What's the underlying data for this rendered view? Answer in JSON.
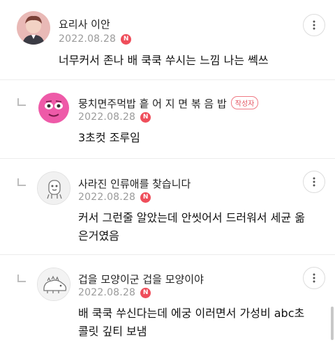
{
  "comments": [
    {
      "nickname": "요리사 이안",
      "date": "2022.08.28",
      "new_badge": "N",
      "body": "너무커서 존나 배 쿡쿡 쑤시는 느낌 나는 쎅쓰",
      "avatar_icon": "photo-avatar",
      "is_reply": false
    },
    {
      "nickname": "뭉치면주먹밥 흩 어 지 면 볶 음 밥",
      "author_badge": "작성자",
      "date": "2022.08.28",
      "new_badge": "N",
      "body": "3초컷 조루임",
      "avatar_icon": "pink-face-avatar",
      "is_reply": true
    },
    {
      "nickname": "사라진 인류애를 찾습니다",
      "date": "2022.08.28",
      "new_badge": "N",
      "body_line1": "커서 그런줄 알았는데 안씻어서 드러워서 세균 옮",
      "body_line2": "은거였음",
      "avatar_icon": "default-character-avatar",
      "is_reply": true
    },
    {
      "nickname": "겁을 모양이군 겁을 모양이야",
      "date": "2022.08.28",
      "new_badge": "N",
      "body_line1": "배 쿡쿡 쑤신다는데 에궁 이러면서 가성비 abc초",
      "body_line2": "콜릿 깊티 보냄",
      "avatar_icon": "dinosaur-avatar",
      "is_reply": true
    }
  ],
  "colors": {
    "accent": "#ef4d5a",
    "meta": "#9a9a9a",
    "divider": "#ececec"
  },
  "more_icon": "more-vertical-icon"
}
